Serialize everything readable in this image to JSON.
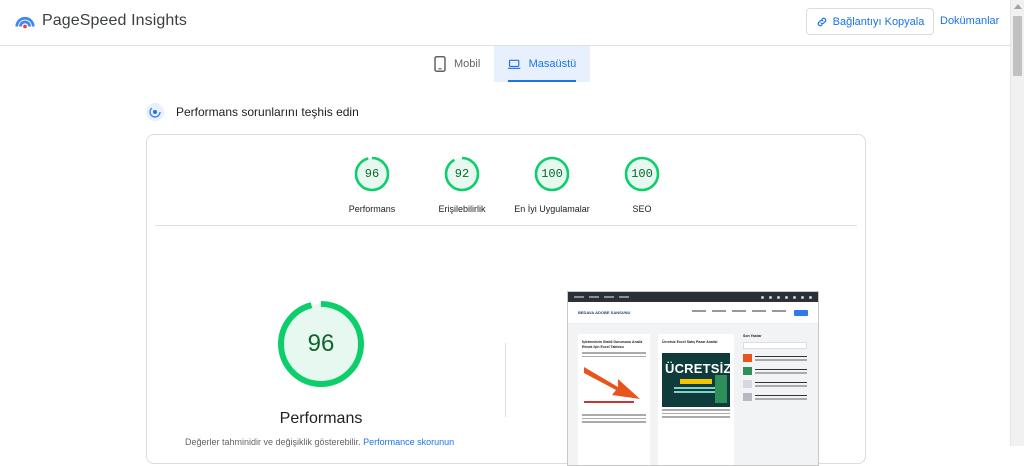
{
  "header": {
    "app_name": "PageSpeed Insights",
    "copy_link_label": "Bağlantıyı Kopyala",
    "docs_label": "Dokümanlar"
  },
  "tabs": [
    {
      "label": "Mobil",
      "icon": "phone-icon",
      "active": false
    },
    {
      "label": "Masaüstü",
      "icon": "laptop-icon",
      "active": true
    }
  ],
  "diagnose": {
    "title": "Performans sorunlarını teşhis edin"
  },
  "scores": [
    {
      "value": "96",
      "label": "Performans",
      "fraction": 0.96
    },
    {
      "value": "92",
      "label": "Erişilebilirlik",
      "fraction": 0.92
    },
    {
      "value": "100",
      "label": "En İyi Uygulamalar",
      "fraction": 1.0
    },
    {
      "value": "100",
      "label": "SEO",
      "fraction": 1.0
    }
  ],
  "main_score": {
    "value": "96",
    "fraction": 0.96,
    "label": "Performans",
    "note_text": "Değerler tahminidir ve değişiklik gösterebilir.",
    "note_link": "Performance skorunun"
  },
  "preview": {
    "site_name": "BEDAVA ADOBE SANSUNU",
    "headline_1": "İşletmenizin Stabil Durumunu Analiz Etmek İçin Excel Tablosu",
    "headline_2": "Ücretsiz Excel Satış Pazar Analizi",
    "banner_word": "ÜCRETSİZ",
    "sidebar_title": "Son Yazılar"
  },
  "colors": {
    "accent": "#1a73e8",
    "score_good": "#0cce6b",
    "score_good_bg": "#e6f8ef",
    "score_text": "#0d652d"
  }
}
